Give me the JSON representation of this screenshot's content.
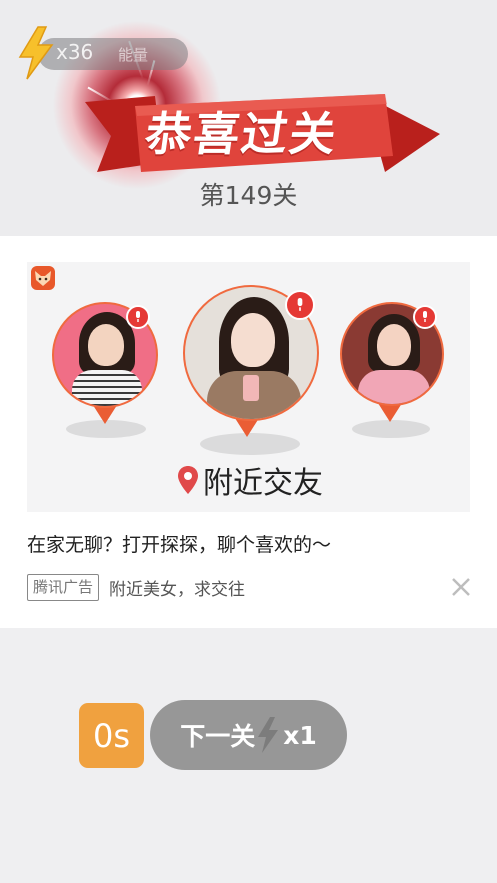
{
  "header": {
    "energy_count": "x36",
    "energy_tag": "能量",
    "title": "恭喜过关",
    "level": "第149关"
  },
  "ad": {
    "app_icon": "fox-app-icon",
    "nearby_label": "附近交友",
    "description": "在家无聊？打开探探，聊个喜欢的～",
    "badge": "腾讯广告",
    "source": "附近美女，求交往"
  },
  "controls": {
    "countdown": "0s",
    "next_label": "下一关",
    "next_multiplier": "x1"
  },
  "colors": {
    "ribbon": "#e0443c",
    "countdown": "#f0a13f",
    "next_button": "#979797",
    "pin_border": "#f06a3f",
    "mic_badge": "#e53935"
  }
}
